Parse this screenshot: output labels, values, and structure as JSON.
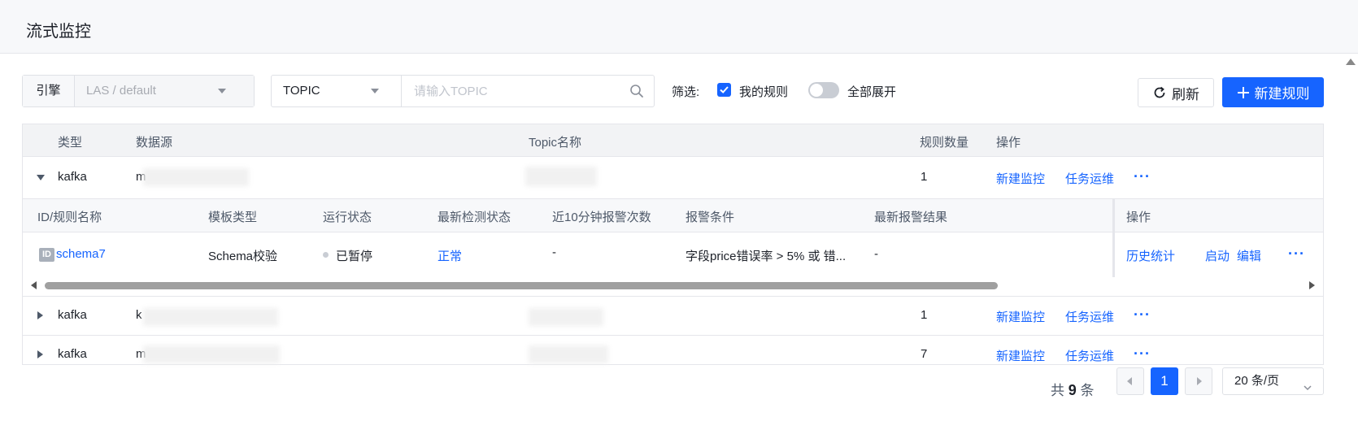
{
  "page": {
    "title": "流式监控"
  },
  "filters": {
    "engine_label": "引擎",
    "engine_value": "LAS / default",
    "topic_select": "TOPIC",
    "topic_placeholder": "请输入TOPIC",
    "filter_label": "筛选:",
    "my_rules_label": "我的规则",
    "my_rules_checked": true,
    "expand_all_label": "全部展开",
    "expand_all_on": false
  },
  "toolbar": {
    "refresh_label": "刷新",
    "new_rule_label": "新建规则"
  },
  "table": {
    "columns": [
      "类型",
      "数据源",
      "Topic名称",
      "规则数量",
      "操作"
    ],
    "rows": [
      {
        "type": "kafka",
        "source_prefix": "m",
        "rule_count": "1",
        "expanded": true,
        "action_new": "新建监控",
        "action_ops": "任务运维",
        "action_more": "···"
      },
      {
        "type": "kafka",
        "source_prefix": "k",
        "rule_count": "1",
        "expanded": false,
        "action_new": "新建监控",
        "action_ops": "任务运维",
        "action_more": "···"
      },
      {
        "type": "kafka",
        "source_prefix": "m",
        "rule_count": "7",
        "expanded": false,
        "action_new": "新建监控",
        "action_ops": "任务运维",
        "action_more": "···"
      }
    ],
    "sub_table": {
      "columns": [
        "ID/规则名称",
        "模板类型",
        "运行状态",
        "最新检测状态",
        "近10分钟报警次数",
        "报警条件",
        "最新报警结果",
        "操作"
      ],
      "rows": [
        {
          "id_badge": "ID",
          "name": "schema7",
          "template": "Schema校验",
          "run_status": "已暂停",
          "latest_check": "正常",
          "alarm_count": "-",
          "condition": "字段price错误率 > 5% 或 错...",
          "latest_result": "-",
          "actions": [
            "历史统计",
            "启动",
            "编辑",
            "···"
          ]
        }
      ]
    }
  },
  "pagination": {
    "total_prefix": "共",
    "total": "9",
    "total_suffix": "条",
    "current_page": "1",
    "page_size": "20 条/页"
  },
  "colors": {
    "primary": "#1664ff",
    "border": "#e5e6eb"
  },
  "icons": [
    "chevron-down-icon",
    "search-icon",
    "check-icon",
    "refresh-icon",
    "plus-icon",
    "caret-down-icon",
    "caret-right-icon",
    "id-icon",
    "more-icon",
    "arrow-left-icon",
    "arrow-right-icon"
  ]
}
